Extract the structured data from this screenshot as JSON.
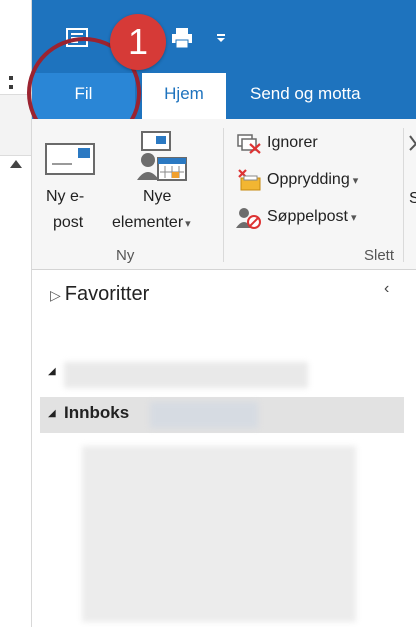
{
  "tabs": {
    "fil": "Fil",
    "hjem": "Hjem",
    "send": "Send og motta"
  },
  "annotation": {
    "step_number": "1"
  },
  "ribbon": {
    "ny_group": {
      "new_email_line1": "Ny e-",
      "new_email_line2": "post",
      "new_items_line1": "Nye",
      "new_items_line2": "elementer",
      "dropdown_caret": "▾",
      "group_label": "Ny"
    },
    "slett_group": {
      "ignore": "Ignorer",
      "cleanup": "Opprydding",
      "junk": "Søppelpost",
      "dropdown_caret": "▾",
      "group_label": "Slett",
      "overflow_letter": "S"
    }
  },
  "nav": {
    "favorites": "Favoritter",
    "inbox": "Innboks",
    "expand_triangle": "▷",
    "collapse_triangle": "◢",
    "collapse_chevron": "‹"
  },
  "colors": {
    "title_bar": "#1e73be",
    "selected_tab_fil": "#2a86d6",
    "badge": "#d63a37",
    "annotation_circle": "#9b2330"
  }
}
